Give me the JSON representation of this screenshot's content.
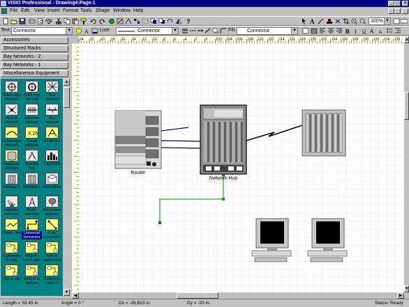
{
  "window": {
    "title": "VISIO Professional - Drawing4:Page-1",
    "minimize": "_",
    "maximize": "□",
    "close": "×"
  },
  "menu": [
    "File",
    "Edit",
    "View",
    "Insert",
    "Format",
    "Tools",
    "Shape",
    "Window",
    "Help"
  ],
  "toolbar": {
    "zoom_value": "100%"
  },
  "format_bar": {
    "text_label": "Text:",
    "text_style": "Connector",
    "line_label": "Line:",
    "line_style": "Connector",
    "fill_label": "Fill:",
    "fill_style": "Connector"
  },
  "stencil_tabs": [
    {
      "label": "Accessories"
    },
    {
      "label": "Structured Racks"
    },
    {
      "label": "Bay Networks - 2"
    },
    {
      "label": "Bay Networks - 1"
    },
    {
      "label": "Miscellaneous Equipment"
    }
  ],
  "masters": [
    {
      "label": "Token-ring network",
      "icon": "token-ring-icon"
    },
    {
      "label": "FDDI ring network",
      "icon": "fddi-ring-icon"
    },
    {
      "label": "Star network",
      "icon": "star-network-icon"
    },
    {
      "label": "Arcnet network",
      "icon": "arcnet-icon"
    },
    {
      "label": "Ethernet network",
      "icon": "ethernet-icon"
    },
    {
      "label": "Bus network",
      "icon": "bus-network-icon"
    },
    {
      "label": "Curved bus network",
      "icon": "curved-bus-icon"
    },
    {
      "label": "Cloud network",
      "icon": "cloud-network-icon"
    },
    {
      "label": "Radio link",
      "icon": "radio-link-icon"
    },
    {
      "label": "Database storage",
      "icon": "database-icon"
    },
    {
      "label": "Satellite link",
      "icon": "satellite-link-icon"
    },
    {
      "label": "City/WAN",
      "icon": "city-wan-icon"
    },
    {
      "label": "Building 1",
      "icon": "building-icon"
    },
    {
      "label": "Building 2",
      "icon": "building-icon"
    },
    {
      "label": "Room/floor",
      "icon": "room-floor-icon"
    },
    {
      "label": "Satellite antenna",
      "icon": "satellite-antenna-icon"
    },
    {
      "label": "Radio antenna",
      "icon": "radio-antenna-icon"
    },
    {
      "label": "Microwave antenna",
      "icon": "microwave-antenna-icon"
    },
    {
      "label": "Comm. link",
      "icon": "comm-link-icon"
    },
    {
      "label": "Universal connector",
      "icon": "universal-connector-icon"
    },
    {
      "label": "Line connector",
      "icon": "line-connector-icon"
    },
    {
      "label": "Top/bottom to side",
      "icon": "connector-icon"
    },
    {
      "label": "Side to same side",
      "icon": "connector-icon"
    },
    {
      "label": "Side to same side",
      "icon": "connector-icon"
    },
    {
      "label": "Top to top",
      "icon": "connector-icon"
    },
    {
      "label": "Bottom to bottom",
      "icon": "connector-icon"
    },
    {
      "label": "Bottom to side 1",
      "icon": "connector-icon"
    }
  ],
  "selected_master": "Universal connector",
  "ruler": {
    "labels": [
      "24",
      "22",
      "20",
      "18",
      "16",
      "14",
      "12",
      "10",
      "8",
      "6",
      "4",
      "2",
      "0",
      "102",
      "104",
      "106",
      "108",
      "110",
      "112",
      "114",
      "116",
      "118",
      "120",
      "122",
      "124",
      "126",
      "128",
      "130",
      "132",
      "134",
      "136"
    ]
  },
  "diagram": {
    "router_label": "Router",
    "hub_label": "Network Hub"
  },
  "status": {
    "length": "Length = 33.45 in.",
    "angle": "Angle = 0 °",
    "dx": "Dx = -26.813 in.",
    "dy": "Dy = -20 in.",
    "status": "Status: Ready"
  },
  "colors": {
    "titlebar": "#000080",
    "stencil_bg": "#008080",
    "connector_end": "#008000"
  }
}
